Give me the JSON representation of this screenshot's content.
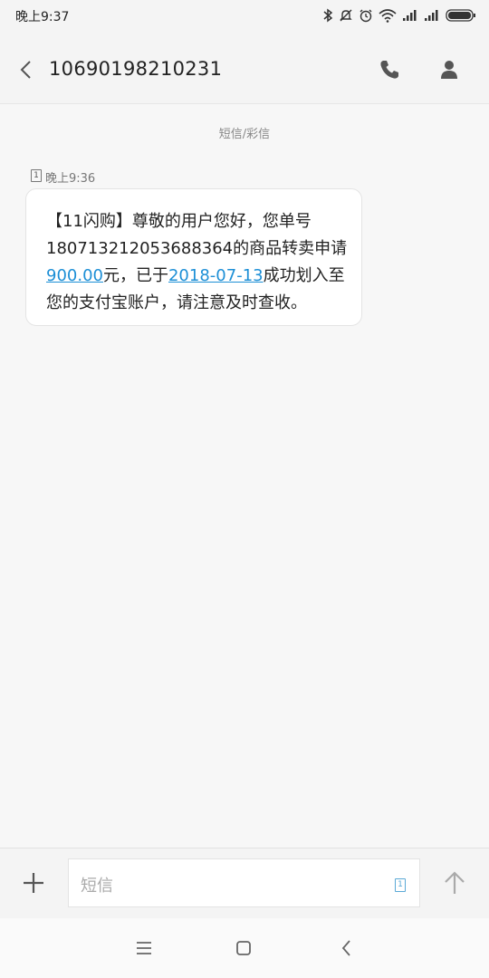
{
  "status_bar": {
    "time": "晚上9:37",
    "icons": [
      "bluetooth-icon",
      "mute-icon",
      "alarm-icon",
      "wifi-icon",
      "signal-icon",
      "signal-icon",
      "battery-icon"
    ]
  },
  "header": {
    "title": "10690198210231",
    "icons": [
      "back-arrow-icon",
      "phone-icon",
      "contact-icon"
    ]
  },
  "thread": {
    "channel_label": "短信/彩信",
    "message": {
      "sim": "1",
      "time": "晚上9:36",
      "line1": "【11闪购】尊敬的用户您好，您单号",
      "line2": "180713212053688364的商品转卖申请",
      "amount": "900.00",
      "line3_mid": "元，已于",
      "date": "2018-07-13",
      "line3_end": "成功划入至",
      "line4": "您的支付宝账户，请注意及时查收。"
    }
  },
  "composer": {
    "placeholder": "短信",
    "sim": "1",
    "icons": [
      "plus-icon",
      "send-arrow-icon"
    ]
  },
  "nav_bar": {
    "icons": [
      "menu-icon",
      "home-icon",
      "back-icon"
    ]
  },
  "colors": {
    "link": "#1d8fd6",
    "background": "#f7f7f7",
    "bubble": "#ffffff"
  }
}
